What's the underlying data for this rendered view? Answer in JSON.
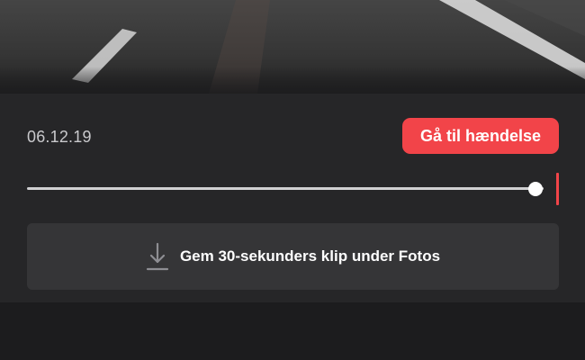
{
  "video": {
    "scene_icon": "dashcam-road-frame"
  },
  "clip": {
    "date": "06.12.19",
    "go_to_event_label": "Gå til hændelse",
    "playback_progress": 0.97,
    "save_label": "Gem 30-sekunders klip under Fotos",
    "save_icon": "download-icon"
  },
  "colors": {
    "accent": "#f24449",
    "panel": "#262628",
    "button_bg": "#353537",
    "background": "#1c1c1e"
  }
}
